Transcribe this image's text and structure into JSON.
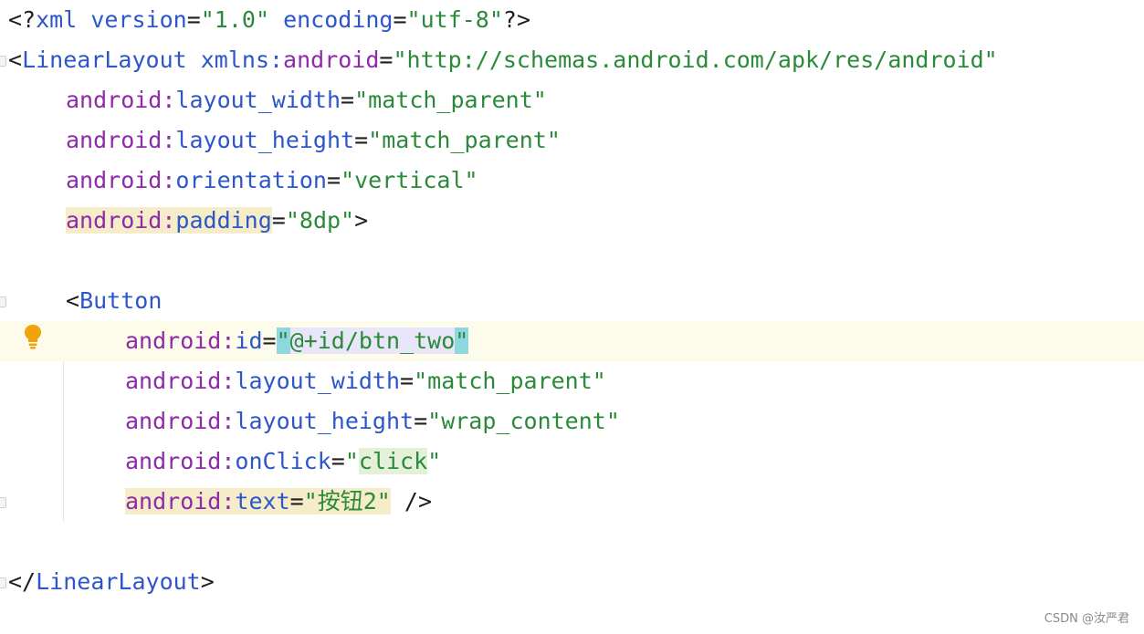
{
  "lines": [
    {
      "parts": [
        {
          "t": "<?",
          "k": "punct"
        },
        {
          "t": "xml",
          "k": "tag"
        },
        {
          "t": " version",
          "k": "attr"
        },
        {
          "t": "=",
          "k": "punct"
        },
        {
          "t": "\"1.0\"",
          "k": "str"
        },
        {
          "t": " encoding",
          "k": "attr"
        },
        {
          "t": "=",
          "k": "punct"
        },
        {
          "t": "\"utf-8\"",
          "k": "str"
        },
        {
          "t": "?>",
          "k": "punct"
        }
      ]
    },
    {
      "parts": [
        {
          "t": "<",
          "k": "punct"
        },
        {
          "t": "LinearLayout",
          "k": "tag"
        },
        {
          "t": " xmlns:",
          "k": "attr"
        },
        {
          "t": "android",
          "k": "ns"
        },
        {
          "t": "=",
          "k": "punct"
        },
        {
          "t": "\"http://schemas.android.com/apk/res/android\"",
          "k": "str"
        }
      ]
    },
    {
      "parts": [
        {
          "t": "android:",
          "k": "ns"
        },
        {
          "t": "layout_width",
          "k": "attr"
        },
        {
          "t": "=",
          "k": "punct"
        },
        {
          "t": "\"match_parent\"",
          "k": "str"
        }
      ]
    },
    {
      "parts": [
        {
          "t": "android:",
          "k": "ns"
        },
        {
          "t": "layout_height",
          "k": "attr"
        },
        {
          "t": "=",
          "k": "punct"
        },
        {
          "t": "\"match_parent\"",
          "k": "str"
        }
      ]
    },
    {
      "parts": [
        {
          "t": "android:",
          "k": "ns"
        },
        {
          "t": "orientation",
          "k": "attr"
        },
        {
          "t": "=",
          "k": "punct"
        },
        {
          "t": "\"vertical\"",
          "k": "str"
        }
      ]
    },
    {
      "parts": [
        {
          "t": "android:",
          "k": "ns",
          "h": "yellow"
        },
        {
          "t": "padding",
          "k": "attr",
          "h": "yellow"
        },
        {
          "t": "=",
          "k": "punct"
        },
        {
          "t": "\"8dp\"",
          "k": "str"
        },
        {
          "t": ">",
          "k": "punct"
        }
      ]
    },
    {
      "parts": []
    },
    {
      "parts": [
        {
          "t": "<",
          "k": "punct"
        },
        {
          "t": "Button",
          "k": "tag"
        }
      ]
    },
    {
      "parts": [
        {
          "t": "android:",
          "k": "ns"
        },
        {
          "t": "id",
          "k": "attr"
        },
        {
          "t": "=",
          "k": "punct"
        },
        {
          "t": "\"",
          "k": "str",
          "h": "quote"
        },
        {
          "t": "@+id/btn_two",
          "k": "str",
          "h": "id"
        },
        {
          "t": "\"",
          "k": "str",
          "h": "quote"
        }
      ]
    },
    {
      "parts": [
        {
          "t": "android:",
          "k": "ns"
        },
        {
          "t": "layout_width",
          "k": "attr"
        },
        {
          "t": "=",
          "k": "punct"
        },
        {
          "t": "\"match_parent\"",
          "k": "str"
        }
      ]
    },
    {
      "parts": [
        {
          "t": "android:",
          "k": "ns"
        },
        {
          "t": "layout_height",
          "k": "attr"
        },
        {
          "t": "=",
          "k": "punct"
        },
        {
          "t": "\"wrap_content\"",
          "k": "str"
        }
      ]
    },
    {
      "parts": [
        {
          "t": "android:",
          "k": "ns"
        },
        {
          "t": "onClick",
          "k": "attr"
        },
        {
          "t": "=",
          "k": "punct"
        },
        {
          "t": "\"",
          "k": "str"
        },
        {
          "t": "click",
          "k": "str",
          "h": "green"
        },
        {
          "t": "\"",
          "k": "str"
        }
      ]
    },
    {
      "parts": [
        {
          "t": "android:",
          "k": "ns",
          "h": "yellow"
        },
        {
          "t": "text",
          "k": "attr",
          "h": "yellow"
        },
        {
          "t": "=",
          "k": "punct",
          "h": "yellow"
        },
        {
          "t": "\"按钮2\"",
          "k": "str",
          "h": "yellow"
        },
        {
          "t": " />",
          "k": "punct"
        }
      ]
    },
    {
      "parts": []
    },
    {
      "parts": [
        {
          "t": "</",
          "k": "punct"
        },
        {
          "t": "LinearLayout",
          "k": "tag"
        },
        {
          "t": ">",
          "k": "punct"
        }
      ]
    }
  ],
  "icons": {
    "intention": "lightbulb-icon",
    "fold": "fold-marker-icon"
  },
  "colors": {
    "tag": "#2c56c9",
    "namespace": "#8f2aa8",
    "string": "#2a8a3a",
    "caret_line": "#fdfbea"
  },
  "watermark": "CSDN @汝严君"
}
